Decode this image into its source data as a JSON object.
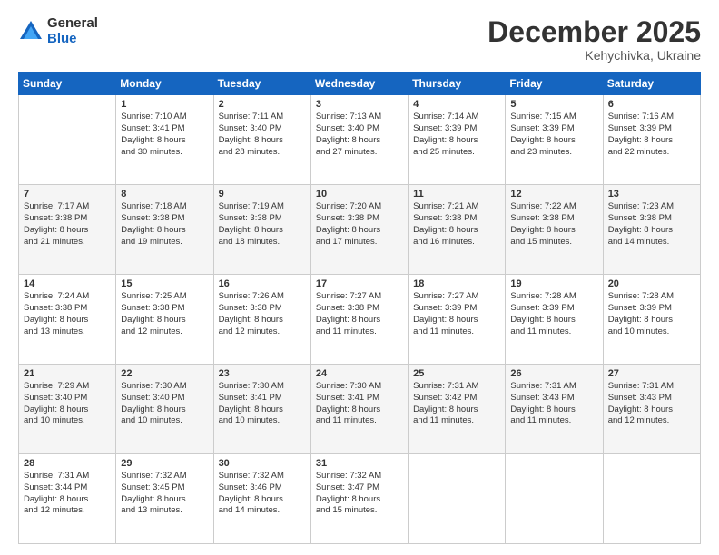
{
  "header": {
    "logo_general": "General",
    "logo_blue": "Blue",
    "month_title": "December 2025",
    "location": "Kehychivka, Ukraine"
  },
  "weekdays": [
    "Sunday",
    "Monday",
    "Tuesday",
    "Wednesday",
    "Thursday",
    "Friday",
    "Saturday"
  ],
  "weeks": [
    [
      {
        "day": "",
        "content": ""
      },
      {
        "day": "1",
        "content": "Sunrise: 7:10 AM\nSunset: 3:41 PM\nDaylight: 8 hours\nand 30 minutes."
      },
      {
        "day": "2",
        "content": "Sunrise: 7:11 AM\nSunset: 3:40 PM\nDaylight: 8 hours\nand 28 minutes."
      },
      {
        "day": "3",
        "content": "Sunrise: 7:13 AM\nSunset: 3:40 PM\nDaylight: 8 hours\nand 27 minutes."
      },
      {
        "day": "4",
        "content": "Sunrise: 7:14 AM\nSunset: 3:39 PM\nDaylight: 8 hours\nand 25 minutes."
      },
      {
        "day": "5",
        "content": "Sunrise: 7:15 AM\nSunset: 3:39 PM\nDaylight: 8 hours\nand 23 minutes."
      },
      {
        "day": "6",
        "content": "Sunrise: 7:16 AM\nSunset: 3:39 PM\nDaylight: 8 hours\nand 22 minutes."
      }
    ],
    [
      {
        "day": "7",
        "content": "Sunrise: 7:17 AM\nSunset: 3:38 PM\nDaylight: 8 hours\nand 21 minutes."
      },
      {
        "day": "8",
        "content": "Sunrise: 7:18 AM\nSunset: 3:38 PM\nDaylight: 8 hours\nand 19 minutes."
      },
      {
        "day": "9",
        "content": "Sunrise: 7:19 AM\nSunset: 3:38 PM\nDaylight: 8 hours\nand 18 minutes."
      },
      {
        "day": "10",
        "content": "Sunrise: 7:20 AM\nSunset: 3:38 PM\nDaylight: 8 hours\nand 17 minutes."
      },
      {
        "day": "11",
        "content": "Sunrise: 7:21 AM\nSunset: 3:38 PM\nDaylight: 8 hours\nand 16 minutes."
      },
      {
        "day": "12",
        "content": "Sunrise: 7:22 AM\nSunset: 3:38 PM\nDaylight: 8 hours\nand 15 minutes."
      },
      {
        "day": "13",
        "content": "Sunrise: 7:23 AM\nSunset: 3:38 PM\nDaylight: 8 hours\nand 14 minutes."
      }
    ],
    [
      {
        "day": "14",
        "content": "Sunrise: 7:24 AM\nSunset: 3:38 PM\nDaylight: 8 hours\nand 13 minutes."
      },
      {
        "day": "15",
        "content": "Sunrise: 7:25 AM\nSunset: 3:38 PM\nDaylight: 8 hours\nand 12 minutes."
      },
      {
        "day": "16",
        "content": "Sunrise: 7:26 AM\nSunset: 3:38 PM\nDaylight: 8 hours\nand 12 minutes."
      },
      {
        "day": "17",
        "content": "Sunrise: 7:27 AM\nSunset: 3:38 PM\nDaylight: 8 hours\nand 11 minutes."
      },
      {
        "day": "18",
        "content": "Sunrise: 7:27 AM\nSunset: 3:39 PM\nDaylight: 8 hours\nand 11 minutes."
      },
      {
        "day": "19",
        "content": "Sunrise: 7:28 AM\nSunset: 3:39 PM\nDaylight: 8 hours\nand 11 minutes."
      },
      {
        "day": "20",
        "content": "Sunrise: 7:28 AM\nSunset: 3:39 PM\nDaylight: 8 hours\nand 10 minutes."
      }
    ],
    [
      {
        "day": "21",
        "content": "Sunrise: 7:29 AM\nSunset: 3:40 PM\nDaylight: 8 hours\nand 10 minutes."
      },
      {
        "day": "22",
        "content": "Sunrise: 7:30 AM\nSunset: 3:40 PM\nDaylight: 8 hours\nand 10 minutes."
      },
      {
        "day": "23",
        "content": "Sunrise: 7:30 AM\nSunset: 3:41 PM\nDaylight: 8 hours\nand 10 minutes."
      },
      {
        "day": "24",
        "content": "Sunrise: 7:30 AM\nSunset: 3:41 PM\nDaylight: 8 hours\nand 11 minutes."
      },
      {
        "day": "25",
        "content": "Sunrise: 7:31 AM\nSunset: 3:42 PM\nDaylight: 8 hours\nand 11 minutes."
      },
      {
        "day": "26",
        "content": "Sunrise: 7:31 AM\nSunset: 3:43 PM\nDaylight: 8 hours\nand 11 minutes."
      },
      {
        "day": "27",
        "content": "Sunrise: 7:31 AM\nSunset: 3:43 PM\nDaylight: 8 hours\nand 12 minutes."
      }
    ],
    [
      {
        "day": "28",
        "content": "Sunrise: 7:31 AM\nSunset: 3:44 PM\nDaylight: 8 hours\nand 12 minutes."
      },
      {
        "day": "29",
        "content": "Sunrise: 7:32 AM\nSunset: 3:45 PM\nDaylight: 8 hours\nand 13 minutes."
      },
      {
        "day": "30",
        "content": "Sunrise: 7:32 AM\nSunset: 3:46 PM\nDaylight: 8 hours\nand 14 minutes."
      },
      {
        "day": "31",
        "content": "Sunrise: 7:32 AM\nSunset: 3:47 PM\nDaylight: 8 hours\nand 15 minutes."
      },
      {
        "day": "",
        "content": ""
      },
      {
        "day": "",
        "content": ""
      },
      {
        "day": "",
        "content": ""
      }
    ]
  ]
}
